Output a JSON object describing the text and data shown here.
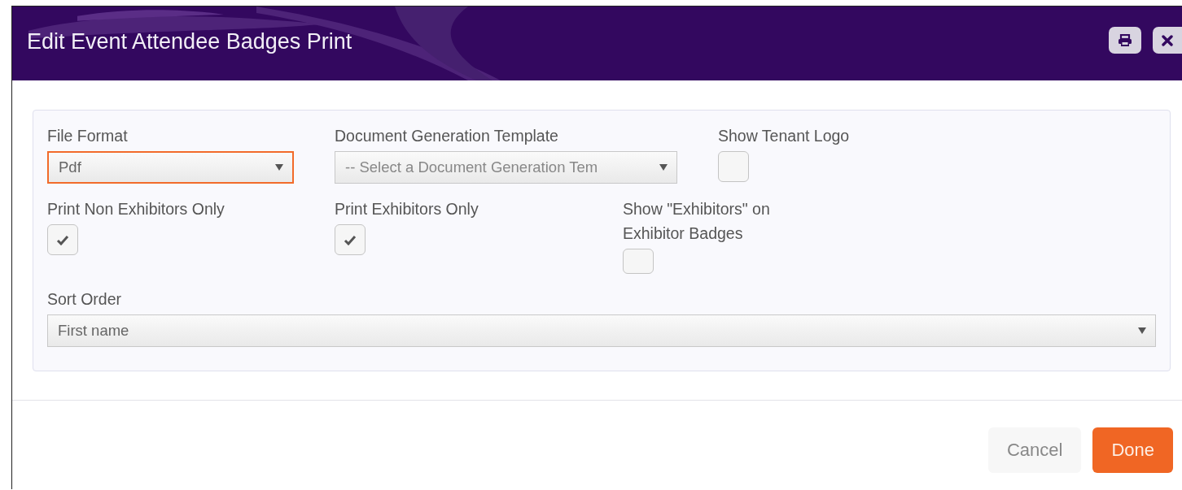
{
  "dialog": {
    "title": "Edit Event Attendee Badges Print"
  },
  "rows": [
    [
      {
        "kind": "select",
        "label": "File Format",
        "value": "Pdf",
        "placeholder_shown": false,
        "focused": true
      },
      {
        "kind": "select",
        "label": "Document Generation Template",
        "value": "-- Select a Document Generation Tem",
        "placeholder_shown": true,
        "focused": false
      },
      {
        "kind": "checkbox",
        "label": "Show Tenant Logo",
        "checked": false
      }
    ],
    [
      {
        "kind": "checkbox",
        "label": "Print Non Exhibitors Only",
        "checked": true
      },
      {
        "kind": "checkbox",
        "label": "Print Exhibitors Only",
        "checked": true
      },
      {
        "kind": "checkbox",
        "label": "Show \"Exhibitors\" on Exhibitor Badges",
        "checked": false
      }
    ],
    [
      {
        "kind": "select",
        "label": "Sort Order",
        "value": "First name",
        "placeholder_shown": false,
        "focused": false
      }
    ]
  ],
  "buttons": [
    {
      "label": "Cancel",
      "kind": "secondary"
    },
    {
      "label": "Done",
      "kind": "primary"
    }
  ]
}
